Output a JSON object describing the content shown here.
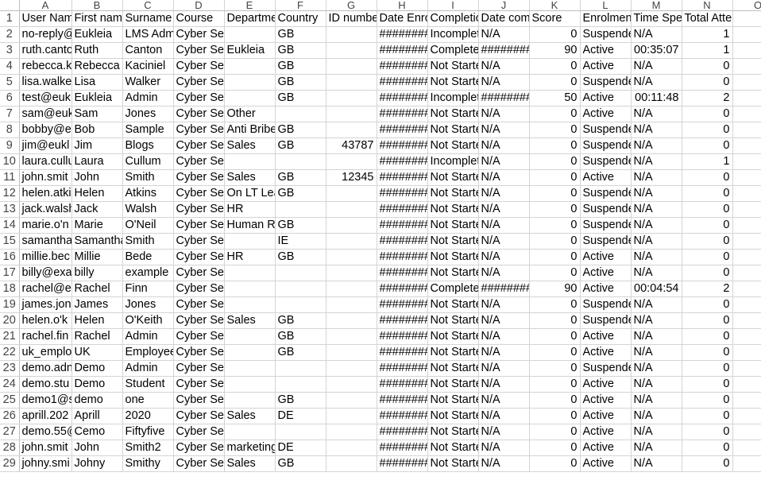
{
  "columns": [
    "A",
    "B",
    "C",
    "D",
    "E",
    "F",
    "G",
    "H",
    "I",
    "J",
    "K",
    "L",
    "M",
    "N",
    "O"
  ],
  "rows": [
    {
      "n": "1",
      "cells": [
        "User Nam",
        "First name",
        "Surname",
        "Course",
        "Departme",
        "Country",
        "ID numbe",
        "Date Enro",
        "Completic",
        "Date comp",
        "Score",
        "Enrolmen",
        "Time Sper",
        "Total Attempts",
        ""
      ]
    },
    {
      "n": "2",
      "cells": [
        "no-reply@",
        "Eukleia",
        "LMS Admi",
        "Cyber Security",
        "",
        "GB",
        "",
        "#########",
        "Incomplet",
        "N/A",
        "0",
        "Suspende",
        "N/A",
        "1",
        ""
      ]
    },
    {
      "n": "3",
      "cells": [
        "ruth.canto",
        "Ruth",
        "Canton",
        "Cyber Sec",
        "Eukleia",
        "GB",
        "",
        "#########",
        "Complete",
        "#########",
        "90",
        "Active",
        "00:35:07",
        "1",
        ""
      ]
    },
    {
      "n": "4",
      "cells": [
        "rebecca.ka",
        "Rebecca",
        "Kaciniel",
        "Cyber Security",
        "",
        "GB",
        "",
        "#########",
        "Not Starte",
        "N/A",
        "0",
        "Active",
        "N/A",
        "0",
        ""
      ]
    },
    {
      "n": "5",
      "cells": [
        "lisa.walke",
        "Lisa",
        "Walker",
        "Cyber Security",
        "",
        "GB",
        "",
        "#########",
        "Not Starte",
        "N/A",
        "0",
        "Suspende",
        "N/A",
        "0",
        ""
      ]
    },
    {
      "n": "6",
      "cells": [
        "test@euk",
        "Eukleia",
        "Admin",
        "Cyber Security",
        "",
        "GB",
        "",
        "#########",
        "Incomplet",
        "#########",
        "50",
        "Active",
        "00:11:48",
        "2",
        ""
      ]
    },
    {
      "n": "7",
      "cells": [
        "sam@euk",
        "Sam",
        "Jones",
        "Cyber Sec",
        "Other",
        "",
        "",
        "#########",
        "Not Starte",
        "N/A",
        "0",
        "Active",
        "N/A",
        "0",
        ""
      ]
    },
    {
      "n": "8",
      "cells": [
        "bobby@e",
        "Bob",
        "Sample",
        "Cyber Sec",
        "Anti Bribe",
        "GB",
        "",
        "#########",
        "Not Starte",
        "N/A",
        "0",
        "Suspende",
        "N/A",
        "0",
        ""
      ]
    },
    {
      "n": "9",
      "cells": [
        "jim@eukl",
        "Jim",
        "Blogs",
        "Cyber Sec",
        "Sales",
        "GB",
        "43787",
        "#########",
        "Not Starte",
        "N/A",
        "0",
        "Suspende",
        "N/A",
        "0",
        ""
      ]
    },
    {
      "n": "10",
      "cells": [
        "laura.cullu",
        "Laura",
        "Cullum",
        "Cyber Security",
        "",
        "",
        "",
        "#########",
        "Incomplet",
        "N/A",
        "0",
        "Suspende",
        "N/A",
        "1",
        ""
      ]
    },
    {
      "n": "11",
      "cells": [
        "john.smit",
        "John",
        "Smith",
        "Cyber Sec",
        "Sales",
        "GB",
        "12345",
        "#########",
        "Not Starte",
        "N/A",
        "0",
        "Active",
        "N/A",
        "0",
        ""
      ]
    },
    {
      "n": "12",
      "cells": [
        "helen.atki",
        "Helen",
        "Atkins",
        "Cyber Sec",
        "On LT Lea",
        "GB",
        "",
        "#########",
        "Not Starte",
        "N/A",
        "0",
        "Suspende",
        "N/A",
        "0",
        ""
      ]
    },
    {
      "n": "13",
      "cells": [
        "jack.walsh",
        "Jack",
        "Walsh",
        "Cyber Sec",
        "HR",
        "",
        "",
        "#########",
        "Not Starte",
        "N/A",
        "0",
        "Suspende",
        "N/A",
        "0",
        ""
      ]
    },
    {
      "n": "14",
      "cells": [
        "marie.o'n",
        "Marie",
        "O'Neil",
        "Cyber Sec",
        "Human Re",
        "GB",
        "",
        "#########",
        "Not Starte",
        "N/A",
        "0",
        "Suspende",
        "N/A",
        "0",
        ""
      ]
    },
    {
      "n": "15",
      "cells": [
        "samantha",
        "Samantha",
        "Smith",
        "Cyber Security",
        "",
        "IE",
        "",
        "#########",
        "Not Starte",
        "N/A",
        "0",
        "Suspende",
        "N/A",
        "0",
        ""
      ]
    },
    {
      "n": "16",
      "cells": [
        "millie.bec",
        "Millie",
        "Bede",
        "Cyber Sec",
        "HR",
        "GB",
        "",
        "#########",
        "Not Starte",
        "N/A",
        "0",
        "Active",
        "N/A",
        "0",
        ""
      ]
    },
    {
      "n": "17",
      "cells": [
        "billy@exa",
        "billy",
        "example",
        "Cyber Security",
        "",
        "",
        "",
        "#########",
        "Not Starte",
        "N/A",
        "0",
        "Active",
        "N/A",
        "0",
        ""
      ]
    },
    {
      "n": "18",
      "cells": [
        "rachel@e",
        "Rachel",
        "Finn",
        "Cyber Security",
        "",
        "",
        "",
        "#########",
        "Complete",
        "#########",
        "90",
        "Active",
        "00:04:54",
        "2",
        ""
      ]
    },
    {
      "n": "19",
      "cells": [
        "james.jon",
        "James",
        "Jones",
        "Cyber Security",
        "",
        "",
        "",
        "#########",
        "Not Starte",
        "N/A",
        "0",
        "Suspende",
        "N/A",
        "0",
        ""
      ]
    },
    {
      "n": "20",
      "cells": [
        "helen.o'k",
        "Helen",
        "O'Keith",
        "Cyber Sec",
        "Sales",
        "GB",
        "",
        "#########",
        "Not Starte",
        "N/A",
        "0",
        "Suspende",
        "N/A",
        "0",
        ""
      ]
    },
    {
      "n": "21",
      "cells": [
        "rachel.fin",
        "Rachel",
        "Admin",
        "Cyber Security",
        "",
        "GB",
        "",
        "#########",
        "Not Starte",
        "N/A",
        "0",
        "Active",
        "N/A",
        "0",
        ""
      ]
    },
    {
      "n": "22",
      "cells": [
        "uk_emplo",
        "UK",
        "Employee",
        "Cyber Security",
        "",
        "GB",
        "",
        "#########",
        "Not Starte",
        "N/A",
        "0",
        "Active",
        "N/A",
        "0",
        ""
      ]
    },
    {
      "n": "23",
      "cells": [
        "demo.adn",
        "Demo",
        "Admin",
        "Cyber Security",
        "",
        "",
        "",
        "#########",
        "Not Starte",
        "N/A",
        "0",
        "Suspende",
        "N/A",
        "0",
        ""
      ]
    },
    {
      "n": "24",
      "cells": [
        "demo.stu",
        "Demo",
        "Student",
        "Cyber Security",
        "",
        "",
        "",
        "#########",
        "Not Starte",
        "N/A",
        "0",
        "Active",
        "N/A",
        "0",
        ""
      ]
    },
    {
      "n": "25",
      "cells": [
        "demo1@s",
        "demo",
        "one",
        "Cyber Security",
        "",
        "GB",
        "",
        "#########",
        "Not Starte",
        "N/A",
        "0",
        "Active",
        "N/A",
        "0",
        ""
      ]
    },
    {
      "n": "26",
      "cells": [
        "aprill.202",
        "Aprill",
        "2020",
        "Cyber Sec",
        "Sales",
        "DE",
        "",
        "#########",
        "Not Starte",
        "N/A",
        "0",
        "Active",
        "N/A",
        "0",
        ""
      ]
    },
    {
      "n": "27",
      "cells": [
        "demo.55@",
        "Cemo",
        "Fiftyfive",
        "Cyber Security",
        "",
        "",
        "",
        "#########",
        "Not Starte",
        "N/A",
        "0",
        "Active",
        "N/A",
        "0",
        ""
      ]
    },
    {
      "n": "28",
      "cells": [
        "john.smit",
        "John",
        "Smith2",
        "Cyber Sec",
        "marketing",
        "DE",
        "",
        "#########",
        "Not Starte",
        "N/A",
        "0",
        "Active",
        "N/A",
        "0",
        ""
      ]
    },
    {
      "n": "29",
      "cells": [
        "johny.smi",
        "Johny",
        "Smithy",
        "Cyber Sec",
        "Sales",
        "GB",
        "",
        "#########",
        "Not Starte",
        "N/A",
        "0",
        "Active",
        "N/A",
        "0",
        ""
      ]
    }
  ]
}
